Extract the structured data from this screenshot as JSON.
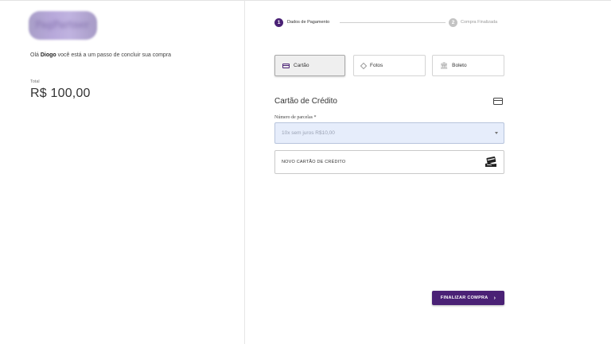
{
  "brand": {
    "logo_text": "PagPartner"
  },
  "left": {
    "greeting_prefix": "Olá",
    "user_name": "Diogo",
    "greeting_suffix": "você está a um passo de concluir sua compra",
    "total_label": "Total",
    "total_value": "R$ 100,00"
  },
  "stepper": {
    "steps": [
      {
        "number": "1",
        "label": "Dados de Pagamento",
        "state": "active"
      },
      {
        "number": "2",
        "label": "Compra Finalizada",
        "state": "inactive"
      }
    ]
  },
  "payment_methods": [
    {
      "label": "Cartão",
      "icon": "credit-card-icon",
      "selected": true
    },
    {
      "label": "Fotos",
      "icon": "diamond-icon",
      "selected": false
    },
    {
      "label": "Boleto",
      "icon": "bank-icon",
      "selected": false
    }
  ],
  "credit_card": {
    "title": "Cartão de Crédito",
    "icon": "credit-card-icon",
    "installments_label": "Número de parcelas",
    "required_mark": "*",
    "installments_value": "10x sem juros R$10,00",
    "new_card_label": "NOVO CARTÃO DE CRÉDITO",
    "new_card_icon": "card-in-hand-icon"
  },
  "actions": {
    "finalize_label": "FINALIZAR COMPRA",
    "finalize_icon": "chevron-right-icon"
  },
  "colors": {
    "accent": "#4a2175",
    "select_bg": "#e6edfb",
    "inactive_step": "#c3c3c3"
  }
}
